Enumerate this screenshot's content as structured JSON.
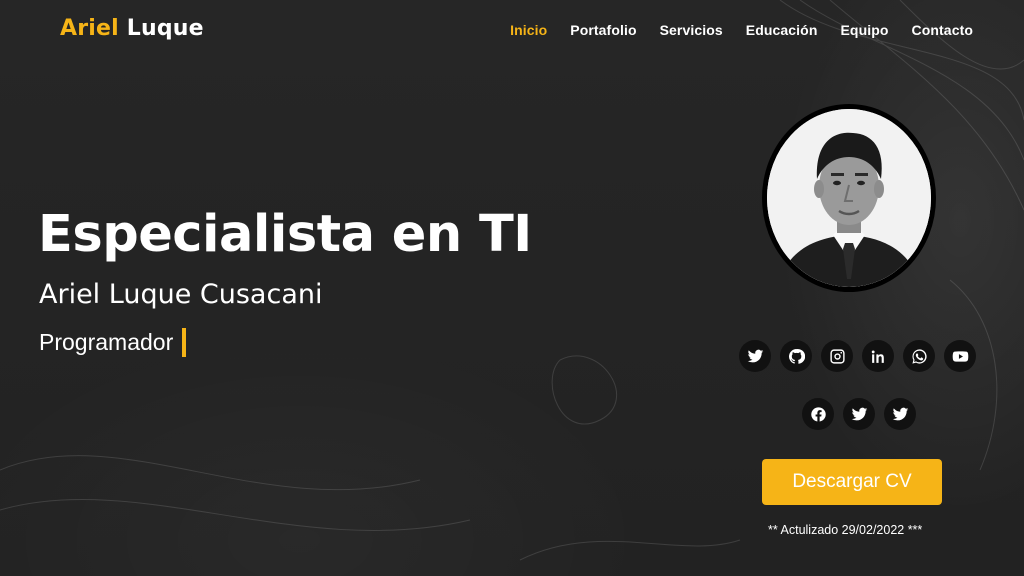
{
  "header": {
    "logo_first": "Ariel",
    "logo_last": "Luque",
    "nav": [
      {
        "label": "Inicio",
        "active": true
      },
      {
        "label": "Portafolio"
      },
      {
        "label": "Servicios"
      },
      {
        "label": "Educación"
      },
      {
        "label": "Equipo"
      },
      {
        "label": "Contacto"
      }
    ]
  },
  "hero": {
    "title": "Especialista en TI",
    "name": "Ariel Luque Cusacani",
    "role": "Programador"
  },
  "social": {
    "row1": [
      "twitter-icon",
      "github-icon",
      "instagram-icon",
      "linkedin-icon",
      "whatsapp-icon",
      "youtube-icon"
    ],
    "row2": [
      "facebook-icon",
      "twitter-icon",
      "twitter-icon"
    ]
  },
  "cta": {
    "download_label": "Descargar CV",
    "updated_text": "** Actulizado 29/02/2022 ***"
  },
  "colors": {
    "accent": "#f6b417",
    "background": "#242424",
    "icon_bg": "#111111"
  }
}
